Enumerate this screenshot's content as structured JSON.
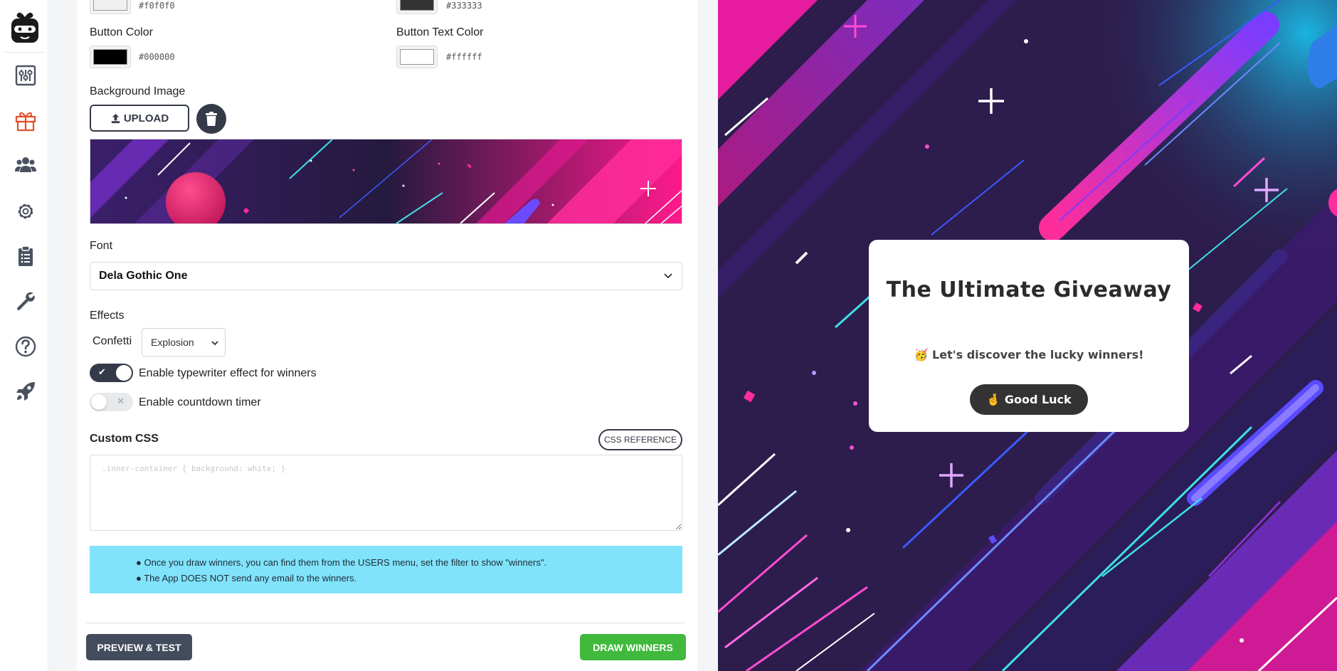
{
  "sidebar": {
    "items": [
      {
        "name": "settings-sliders-icon"
      },
      {
        "name": "gift-icon",
        "active": true,
        "color": "#e0502b"
      },
      {
        "name": "users-icon"
      },
      {
        "name": "gear-icon"
      },
      {
        "name": "clipboard-icon"
      },
      {
        "name": "wrench-icon"
      },
      {
        "name": "help-icon"
      },
      {
        "name": "rocket-icon"
      }
    ]
  },
  "colors": {
    "top_left_hex": "#f0f0f0",
    "top_right_hex": "#333333",
    "button_color_label": "Button Color",
    "button_color_hex": "#000000",
    "button_text_color_label": "Button Text Color",
    "button_text_color_hex": "#ffffff"
  },
  "background_image": {
    "label": "Background Image",
    "upload_label": "UPLOAD"
  },
  "font": {
    "label": "Font",
    "selected": "Dela Gothic One"
  },
  "effects": {
    "label": "Effects",
    "confetti_label": "Confetti",
    "confetti_selected": "Explosion",
    "typewriter_label": "Enable typewriter effect for winners",
    "typewriter_on": true,
    "countdown_label": "Enable countdown timer",
    "countdown_on": false
  },
  "custom_css": {
    "label": "Custom CSS",
    "reference_label": "CSS REFERENCE",
    "placeholder": ".inner-container { background: white; }"
  },
  "info": {
    "line1": "● Once you draw winners, you can find them from the USERS menu, set the filter to show \"winners\".",
    "line2": "● The App DOES NOT send any email to the winners."
  },
  "actions": {
    "preview_label": "PREVIEW & TEST",
    "draw_label": "DRAW WINNERS"
  },
  "preview": {
    "title": "The Ultimate Giveaway",
    "subtitle": "🥳 Let's discover the lucky winners!",
    "button_label": "🤞 Good Luck"
  }
}
